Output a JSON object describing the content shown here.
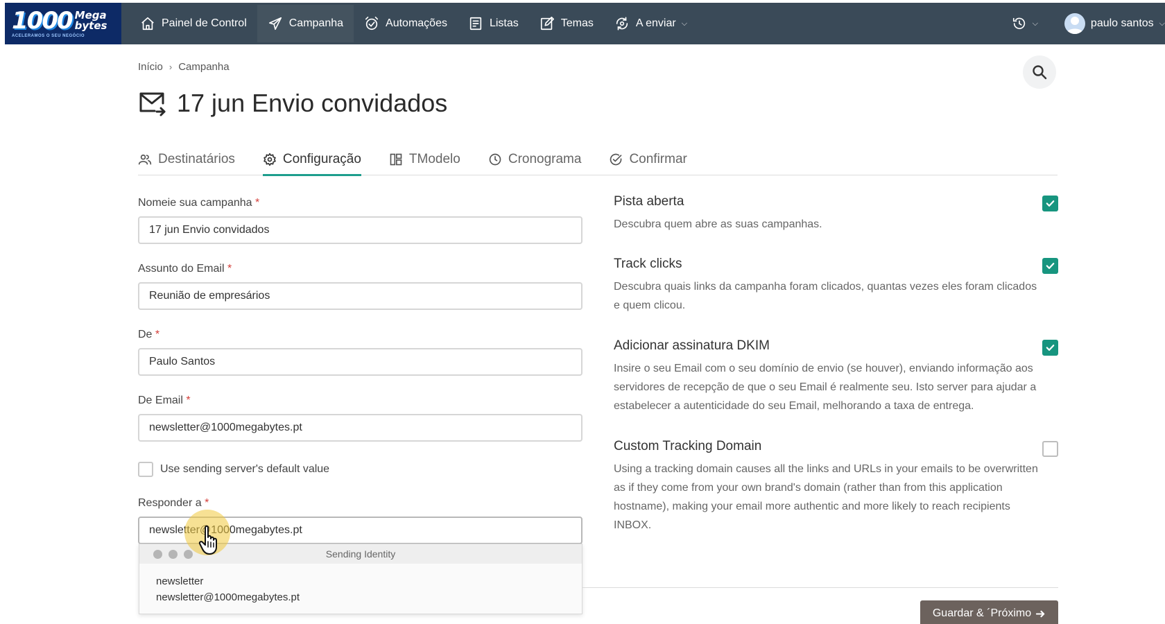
{
  "logo": {
    "number": "1000",
    "word_top": "Mega",
    "word_bottom": "bytes",
    "tagline": "ACELERAMOS O SEU NEGÓCIO"
  },
  "nav": {
    "items": [
      {
        "label": "Painel de Control",
        "icon": "home-icon"
      },
      {
        "label": "Campanha",
        "icon": "paper-plane-icon"
      },
      {
        "label": "Automações",
        "icon": "alarm-clock-icon"
      },
      {
        "label": "Listas",
        "icon": "list-icon"
      },
      {
        "label": "Temas",
        "icon": "edit-icon"
      },
      {
        "label": "A enviar",
        "icon": "sync-icon"
      }
    ],
    "user_name": "paulo santos"
  },
  "breadcrumb": {
    "home": "Início",
    "current": "Campanha"
  },
  "page": {
    "title": "17 jun Envio convidados"
  },
  "tabs": [
    {
      "label": "Destinatários",
      "icon": "users-icon"
    },
    {
      "label": "Configuração",
      "icon": "gear-icon"
    },
    {
      "label": "TModelo",
      "icon": "template-icon"
    },
    {
      "label": "Cronograma",
      "icon": "clock-icon"
    },
    {
      "label": "Confirmar",
      "icon": "check-circle-icon"
    }
  ],
  "form": {
    "campaign_name": {
      "label": "Nomeie sua campanha",
      "value": "17 jun Envio convidados"
    },
    "subject": {
      "label": "Assunto do Email",
      "value": "Reunião de empresários"
    },
    "from_name": {
      "label": "De",
      "value": "Paulo Santos"
    },
    "from_email": {
      "label": "De Email",
      "value": "newsletter@1000megabytes.pt"
    },
    "use_default": {
      "label": "Use sending server's default value",
      "checked": false
    },
    "reply_to": {
      "label": "Responder a",
      "value": "newsletter@1000megabytes.pt"
    },
    "required_mark": "*"
  },
  "dropdown": {
    "title": "Sending Identity",
    "item_name": "newsletter",
    "item_email": "newsletter@1000megabytes.pt"
  },
  "settings": [
    {
      "title": "Pista aberta",
      "desc": "Descubra quem abre as suas campanhas.",
      "checked": true
    },
    {
      "title": "Track clicks",
      "desc": "Descubra quais links da campanha foram clicados, quantas vezes eles foram clicados e quem clicou.",
      "checked": true
    },
    {
      "title": "Adicionar assinatura DKIM",
      "desc": "Insire o seu Email com o seu domínio de envio (se houver), enviando informação aos servidores de recepção de que o seu Email é realmente seu. Isto server para ajudar a estabelecer a autenticidade do seu Email, melhorando a taxa de entrega.",
      "checked": true
    },
    {
      "title": "Custom Tracking Domain",
      "desc": "Using a tracking domain causes all the links and URLs in your emails to be overwritten as if they come from your own brand's domain (rather than from this application hostname), making your email more authentic and more likely to reach recipients INBOX.",
      "checked": false
    }
  ],
  "actions": {
    "save_next": "Guardar & ´Próximo"
  },
  "colors": {
    "nav_bg": "#3a4a58",
    "accent": "#17957f",
    "button": "#6c625d",
    "required": "#d43f3a"
  }
}
